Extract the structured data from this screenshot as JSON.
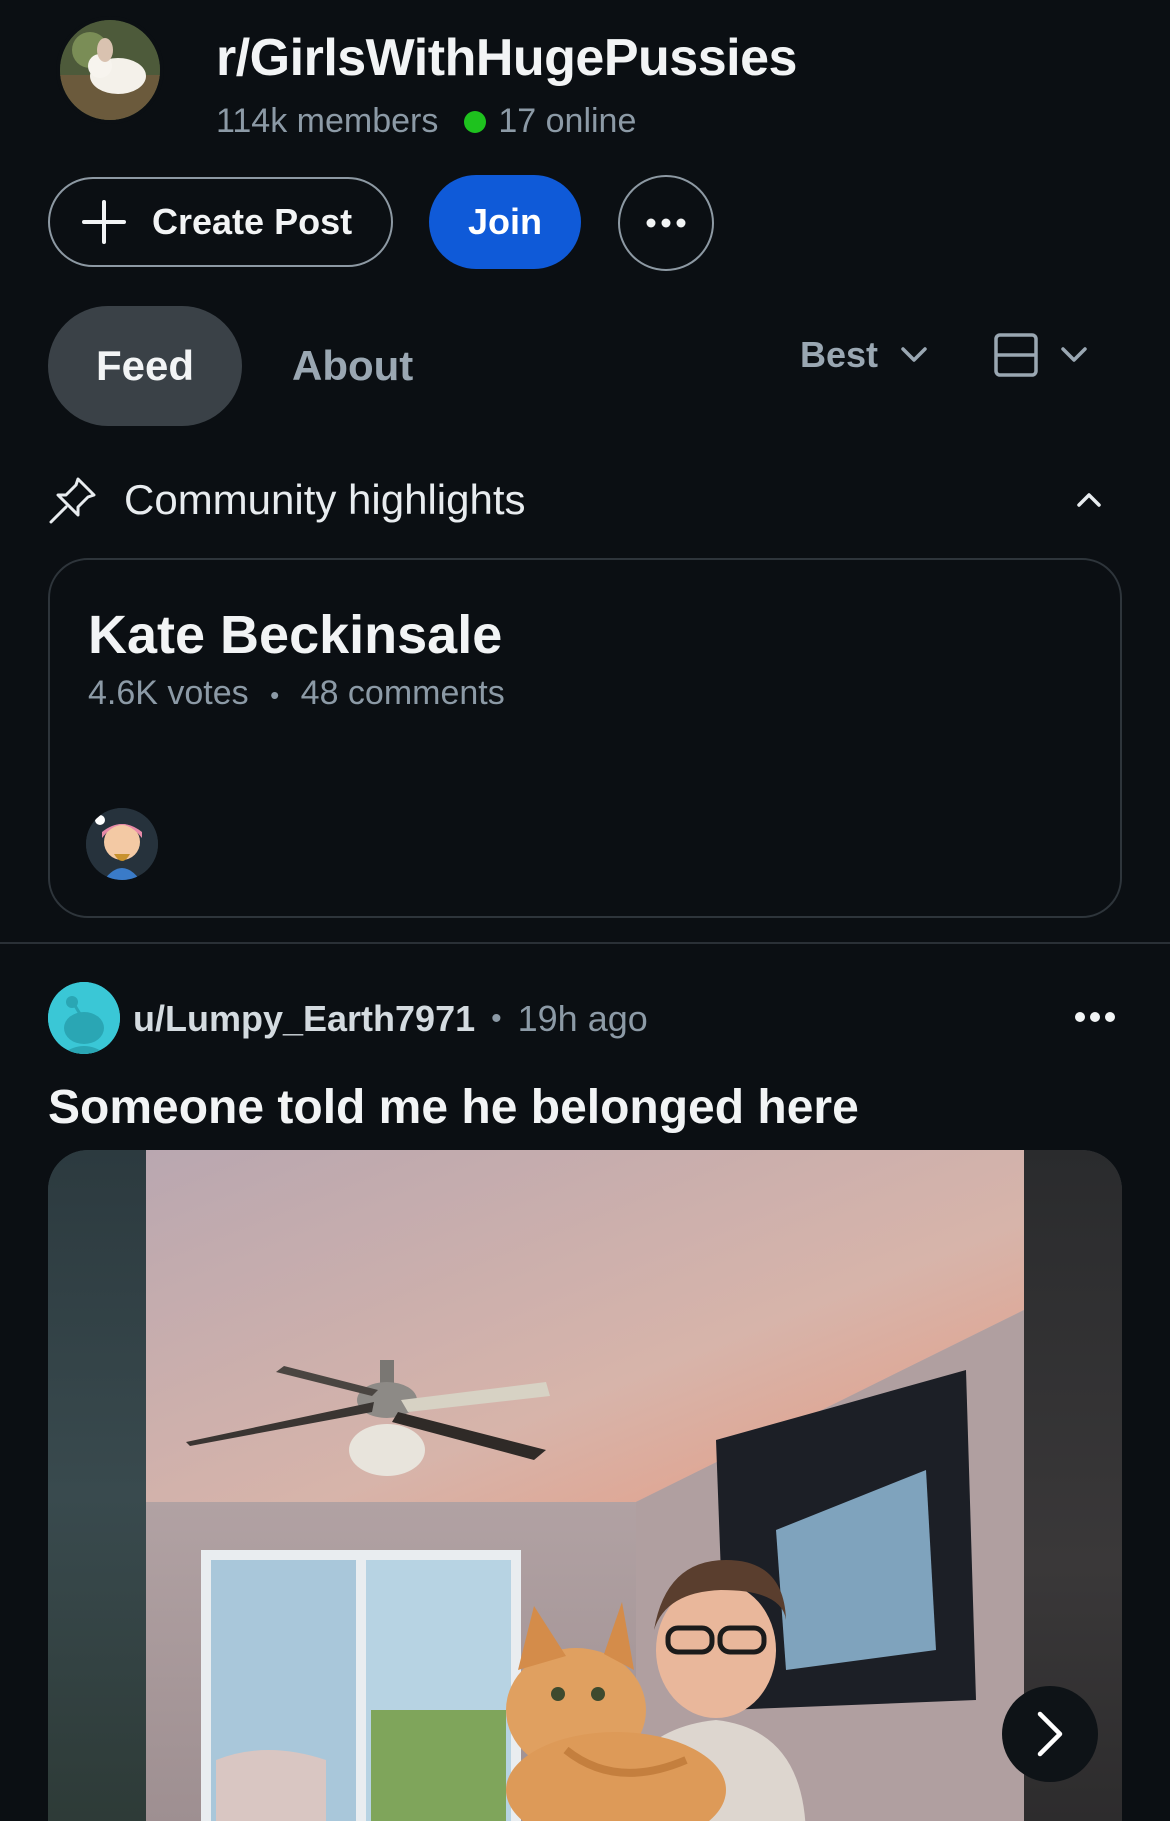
{
  "subreddit": {
    "name": "r/GirlsWithHugePussies",
    "members": "114k members",
    "online": "17 online"
  },
  "actions": {
    "create_post": "Create Post",
    "join": "Join"
  },
  "tabs": {
    "feed": "Feed",
    "about": "About"
  },
  "sort": {
    "label": "Best"
  },
  "highlights": {
    "title": "Community highlights",
    "card": {
      "title": "Kate Beckinsale",
      "votes": "4.6K votes",
      "separator": "•",
      "comments": "48 comments"
    }
  },
  "post": {
    "user": "u/Lumpy_Earth7971",
    "separator": "•",
    "time": "19h ago",
    "title": "Someone told me he belonged here"
  },
  "colors": {
    "background": "#0b0f13",
    "join_blue": "#0f5ad8",
    "online_green": "#1ec21e",
    "feed_tab_bg": "#3a4147"
  },
  "icons": [
    "plus-icon",
    "more-icon",
    "chevron-down-icon",
    "card-view-icon",
    "pin-icon",
    "chevron-up-icon",
    "arrow-right-icon"
  ]
}
